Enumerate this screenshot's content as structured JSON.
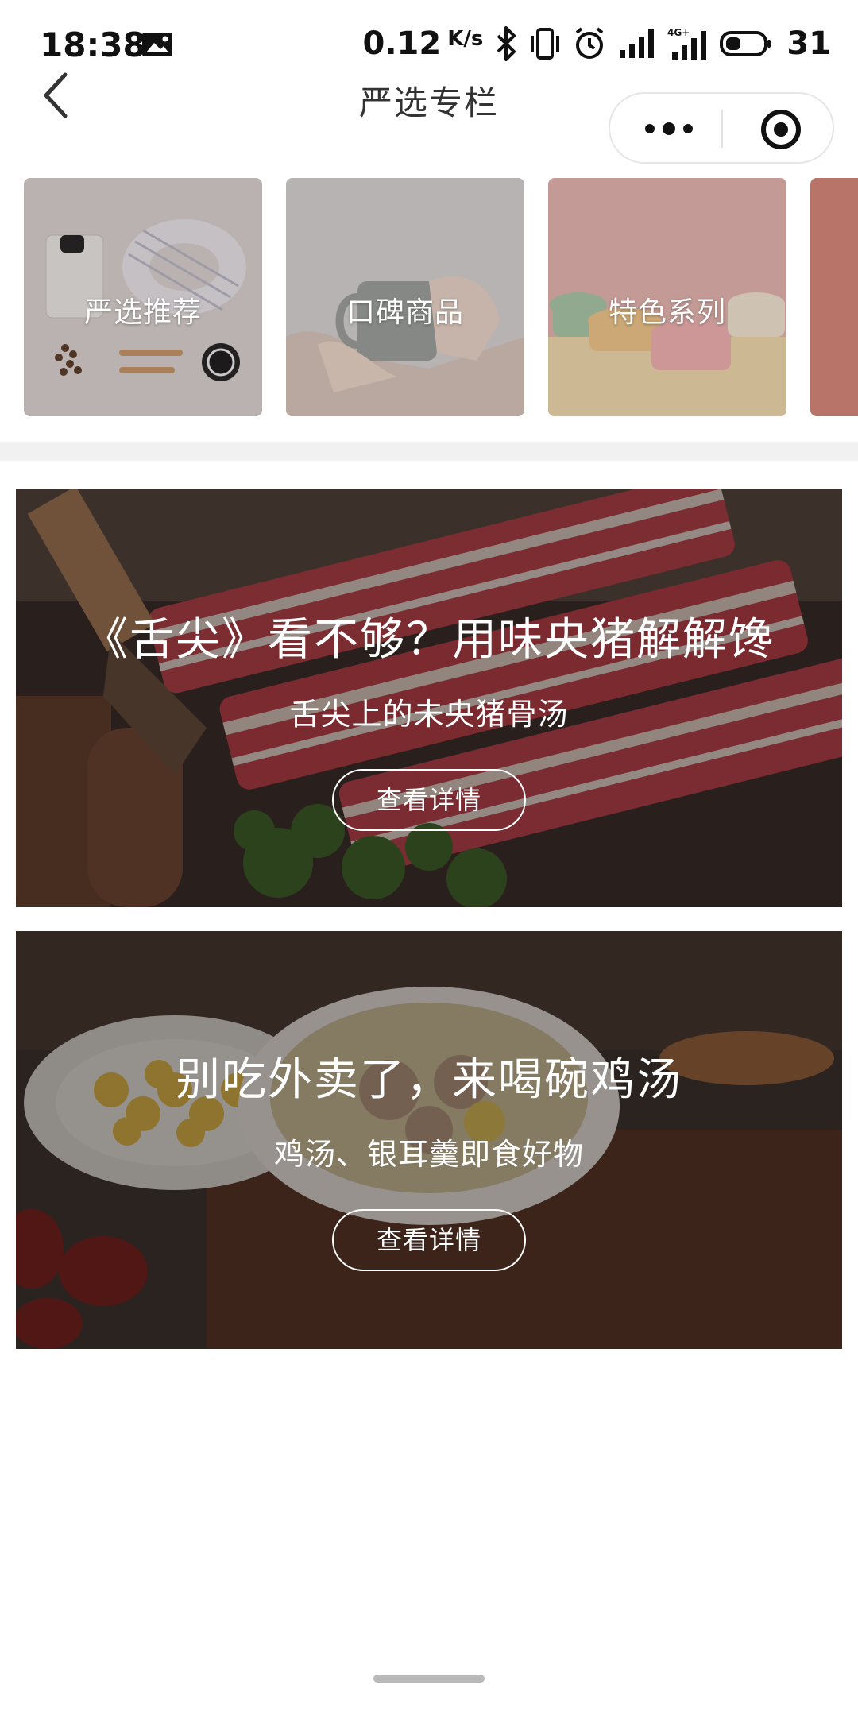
{
  "status_bar": {
    "time": "18:38",
    "net_speed": "0.12",
    "net_speed_unit": "K/s",
    "battery": "31",
    "icons": [
      "image-notification-icon",
      "bluetooth-icon",
      "vibrate-icon",
      "alarm-icon",
      "signal-icon",
      "signal-4g-icon",
      "battery-icon"
    ]
  },
  "nav": {
    "title": "严选专栏",
    "back_icon": "back-arrow-icon",
    "capsule": {
      "more_icon": "more-dots-icon",
      "close_icon": "target-close-icon"
    }
  },
  "categories": [
    {
      "label": "严选推荐"
    },
    {
      "label": "口碑商品"
    },
    {
      "label": "特色系列"
    },
    {
      "label": ""
    }
  ],
  "features": [
    {
      "title": "《舌尖》看不够？用味央猪解解馋",
      "subtitle": "舌尖上的未央猪骨汤",
      "button": "查看详情"
    },
    {
      "title": "别吃外卖了，来喝碗鸡汤",
      "subtitle": "鸡汤、银耳羹即食好物",
      "button": "查看详情"
    }
  ],
  "colors": {
    "accent_text": "#ffffff",
    "divider": "#f1f1f1",
    "title_text": "#333333"
  }
}
